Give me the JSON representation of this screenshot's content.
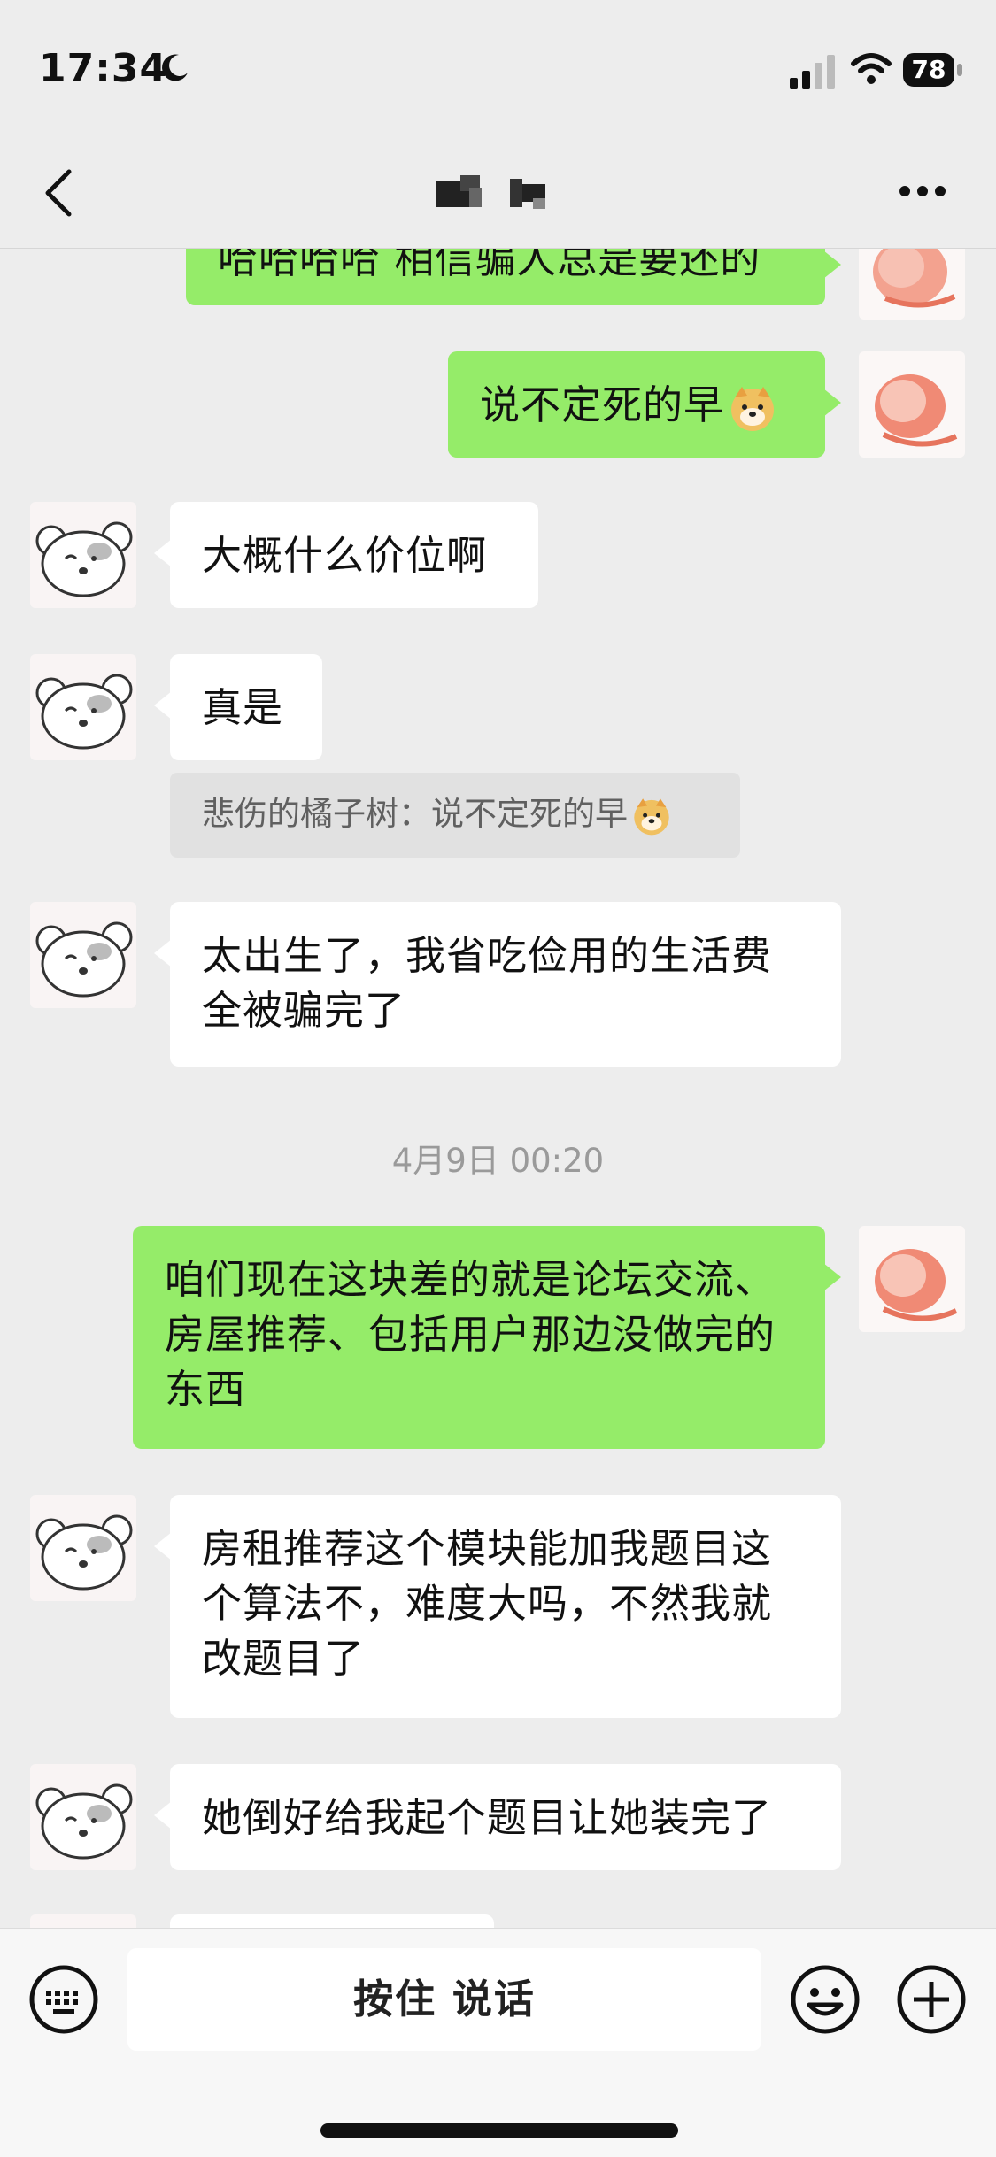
{
  "status_bar": {
    "time": "17:34",
    "battery": "78"
  },
  "chat": {
    "messages": [
      {
        "side": "me",
        "text": "哈哈哈哈 相信骗人总是要还的"
      },
      {
        "side": "me",
        "text": "说不定死的早"
      },
      {
        "side": "other",
        "text": "大概什么价位啊"
      },
      {
        "side": "other",
        "text": "真是"
      },
      {
        "quote": "悲伤的橘子树：说不定死的早"
      },
      {
        "side": "other",
        "text": "太出生了，我省吃俭用的生活费全被骗完了"
      },
      {
        "timestamp": "4月9日 00:20"
      },
      {
        "side": "me",
        "text": "咱们现在这块差的就是论坛交流、房屋推荐、包括用户那边没做完的东西"
      },
      {
        "side": "other",
        "text": "房租推荐这个模块能加我题目这个算法不，难度大吗，不然我就改题目了"
      },
      {
        "side": "other",
        "text": "她倒好给我起个题目让她装完了"
      }
    ]
  },
  "input_bar": {
    "voice_label": "按住 说话"
  },
  "icons": {
    "back": "back-arrow-icon",
    "more": "more-icon",
    "keyboard": "keyboard-icon",
    "emoji": "emoji-icon",
    "plus": "plus-icon",
    "doge_emoji": "doge-emoji-icon"
  },
  "colors": {
    "my_bubble": "#95ec69",
    "other_bubble": "#ffffff",
    "background": "#ededed"
  }
}
